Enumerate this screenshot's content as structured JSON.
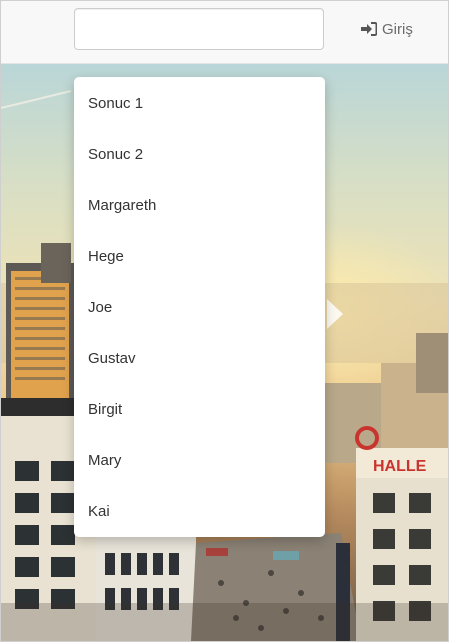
{
  "header": {
    "search": {
      "value": "",
      "placeholder": ""
    },
    "login": {
      "label": "Giriş",
      "icon": "sign-in-icon"
    }
  },
  "dropdown": {
    "items": [
      {
        "label": "Sonuc 1"
      },
      {
        "label": "Sonuc 2"
      },
      {
        "label": "Margareth"
      },
      {
        "label": "Hege"
      },
      {
        "label": "Joe"
      },
      {
        "label": "Gustav"
      },
      {
        "label": "Birgit"
      },
      {
        "label": "Mary"
      },
      {
        "label": "Kai"
      }
    ]
  },
  "hero": {
    "sign_text": "HALLE",
    "colors": {
      "sky": "#d9dfc4",
      "sun": "#ffecaa",
      "sign": "#c9342f"
    }
  }
}
